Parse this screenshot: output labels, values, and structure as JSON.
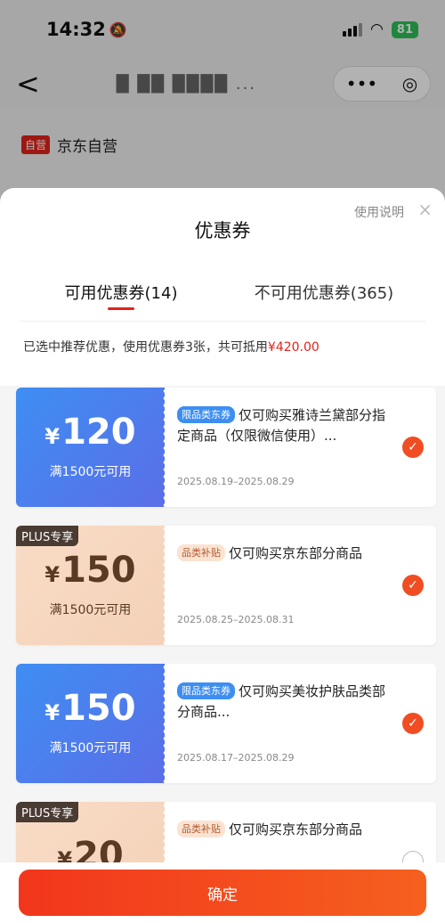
{
  "status": {
    "time": "14:32",
    "battery": "81"
  },
  "nav": {
    "title": "█ ██ ████ ...",
    "back": "<",
    "more": "•••",
    "target": "◎"
  },
  "shop": {
    "self_tag": "自营",
    "name": "京东自营"
  },
  "sheet": {
    "title": "优惠券",
    "help": "使用说明",
    "close": "×",
    "tabs": [
      {
        "label": "可用优惠券(14)",
        "active": true
      },
      {
        "label": "不可用优惠券(365)",
        "active": false
      }
    ],
    "summary_text": "已选中推荐优惠，使用优惠券3张，共可抵用",
    "summary_amount": "¥420.00"
  },
  "coupons": [
    {
      "style": "blue",
      "plus": "",
      "yen": "¥",
      "amount": "120",
      "condition": "满1500元可用",
      "tag": "限品类东券",
      "tag_style": "blue",
      "desc": "仅可购买雅诗兰黛部分指定商品（仅限微信使用）...",
      "date": "2025.08.19–2025.08.29",
      "checked": true
    },
    {
      "style": "peach",
      "plus": "PLUS专享",
      "yen": "¥",
      "amount": "150",
      "condition": "满1500元可用",
      "tag": "品类补贴",
      "tag_style": "peach",
      "desc": "仅可购买京东部分商品",
      "date": "2025.08.25–2025.08.31",
      "checked": true
    },
    {
      "style": "blue",
      "plus": "",
      "yen": "¥",
      "amount": "150",
      "condition": "满1500元可用",
      "tag": "限品类东券",
      "tag_style": "blue",
      "desc": "仅可购买美妆护肤品类部分商品...",
      "date": "2025.08.17–2025.08.29",
      "checked": true
    },
    {
      "style": "peach",
      "plus": "PLUS专享",
      "yen": "¥",
      "amount": "20",
      "condition": "",
      "tag": "品类补贴",
      "tag_style": "peach",
      "desc": "仅可购买京东部分商品",
      "date": "",
      "checked": false
    }
  ],
  "footer": {
    "confirm": "确定"
  },
  "colors": {
    "accent": "#e2231a",
    "button": "#f2361c",
    "blue_coupon": "#3e8ef2",
    "peach_coupon": "#f9dcc6"
  }
}
